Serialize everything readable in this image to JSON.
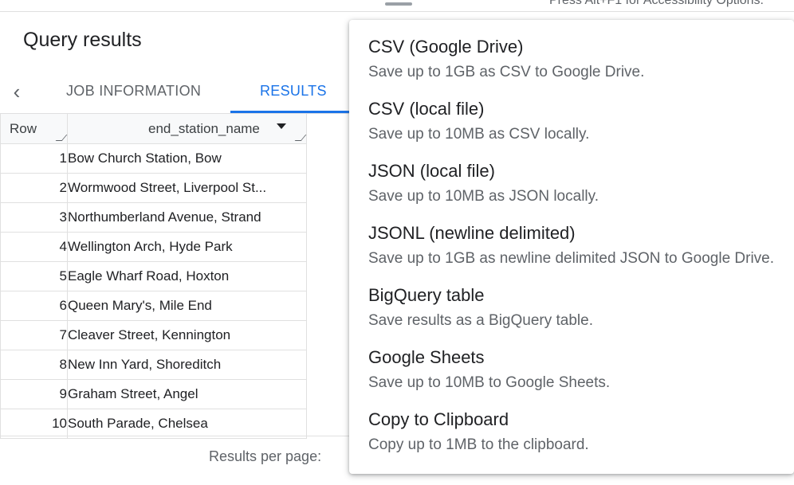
{
  "topbar": {
    "accessibility_hint": "Press Alt+F1 for Accessibility Options."
  },
  "panel": {
    "title": "Query results"
  },
  "tabs": [
    {
      "label": "JOB INFORMATION"
    },
    {
      "label": "RESULTS"
    }
  ],
  "table": {
    "columns": {
      "row": "Row",
      "name": "end_station_name"
    },
    "rows": [
      {
        "row": "1",
        "name": "Bow Church Station, Bow"
      },
      {
        "row": "2",
        "name": "Wormwood Street, Liverpool St..."
      },
      {
        "row": "3",
        "name": "Northumberland Avenue, Strand"
      },
      {
        "row": "4",
        "name": "Wellington Arch, Hyde Park"
      },
      {
        "row": "5",
        "name": "Eagle Wharf Road, Hoxton"
      },
      {
        "row": "6",
        "name": "Queen Mary's, Mile End"
      },
      {
        "row": "7",
        "name": "Cleaver Street, Kennington"
      },
      {
        "row": "8",
        "name": "New Inn Yard, Shoreditch"
      },
      {
        "row": "9",
        "name": "Graham Street, Angel"
      },
      {
        "row": "10",
        "name": "South Parade, Chelsea"
      }
    ]
  },
  "footer": {
    "results_per_page": "Results per page:"
  },
  "menu": {
    "items": [
      {
        "label": "CSV (Google Drive)",
        "desc": "Save up to 1GB as CSV to Google Drive."
      },
      {
        "label": "CSV (local file)",
        "desc": "Save up to 10MB as CSV locally."
      },
      {
        "label": "JSON (local file)",
        "desc": "Save up to 10MB as JSON locally."
      },
      {
        "label": "JSONL (newline delimited)",
        "desc": "Save up to 1GB as newline delimited JSON to Google Drive."
      },
      {
        "label": "BigQuery table",
        "desc": "Save results as a BigQuery table."
      },
      {
        "label": "Google Sheets",
        "desc": "Save up to 10MB to Google Sheets."
      },
      {
        "label": "Copy to Clipboard",
        "desc": "Copy up to 1MB to the clipboard."
      }
    ]
  },
  "colors": {
    "accent": "#1a73e8",
    "text": "#202124",
    "secondary_text": "#5f6368",
    "border": "#e0e0e0"
  },
  "icons": {
    "back": "chevron-left-icon",
    "sort": "sort-down-icon",
    "resize": "column-resize-icon"
  }
}
